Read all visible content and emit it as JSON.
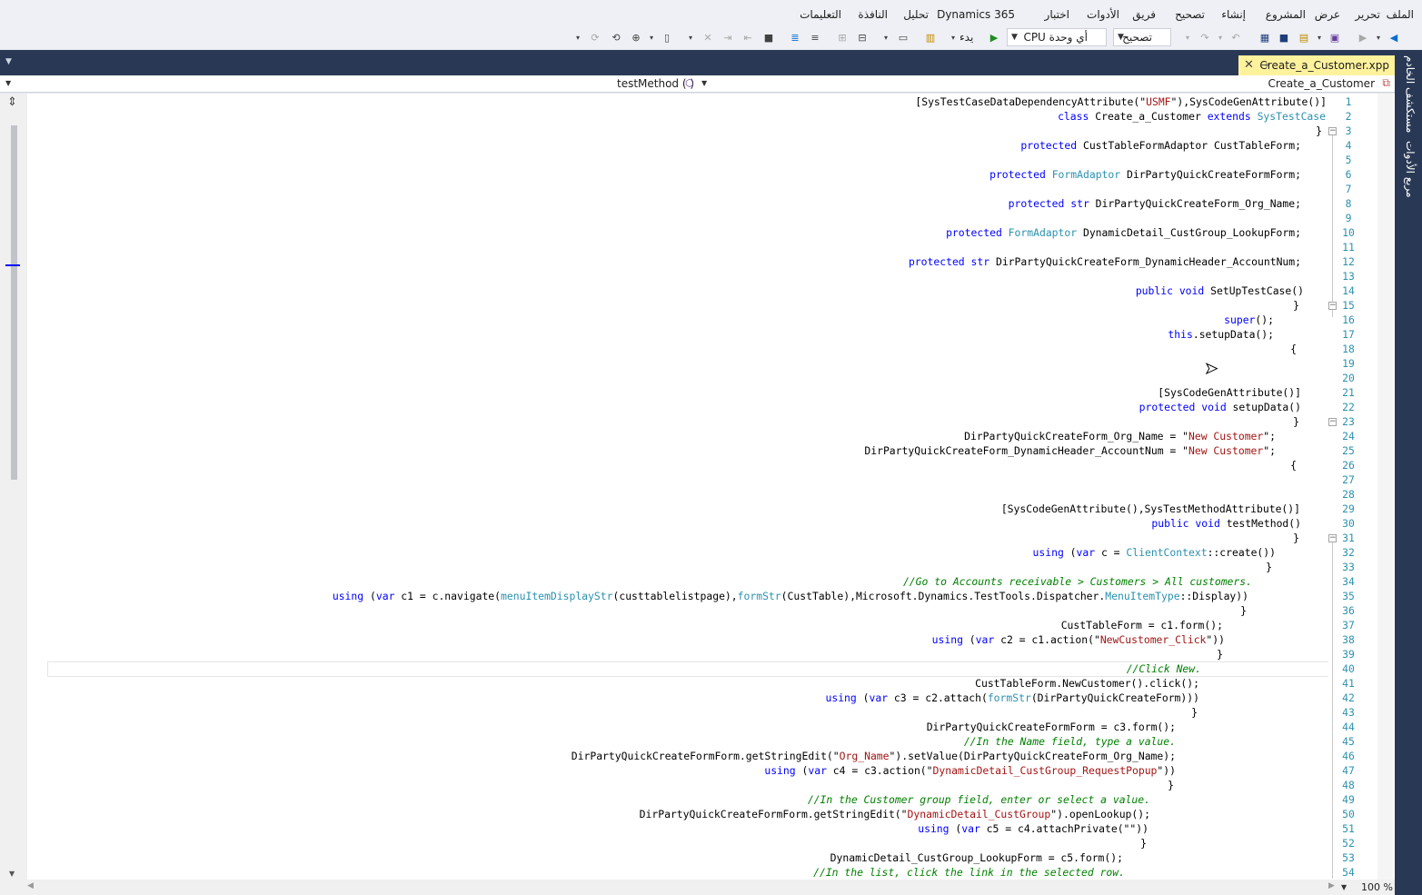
{
  "menu": [
    "الملف",
    "تحرير",
    "عرض",
    "المشروع",
    "إنشاء",
    "تصحيح",
    "فريق",
    "الأدوات",
    "اختبار",
    "Dynamics 365",
    "تحليل",
    "النافذة",
    "التعليمات"
  ],
  "toolbar": {
    "config": "تصحيح",
    "platform": "أي وحدة CPU",
    "start": "يدء"
  },
  "tab": {
    "title": "Create_a_Customer.xpp"
  },
  "side_tabs": [
    "مستكشف الخادم",
    "مربع الأدوات"
  ],
  "nav": {
    "method": "testMethod ( )",
    "class": "Create_a_Customer"
  },
  "zoom": "100 %",
  "line_numbers": [
    "1",
    "2",
    "3",
    "4",
    "5",
    "6",
    "7",
    "8",
    "9",
    "10",
    "11",
    "12",
    "13",
    "14",
    "15",
    "16",
    "17",
    "18",
    "19",
    "20",
    "21",
    "22",
    "23",
    "24",
    "25",
    "26",
    "27",
    "28",
    "29",
    "30",
    "31",
    "32",
    "33",
    "34",
    "35",
    "36",
    "37",
    "38",
    "39",
    "40",
    "41",
    "42",
    "43",
    "44",
    "45",
    "46",
    "47",
    "48",
    "49",
    "50",
    "51",
    "52",
    "53",
    "54"
  ],
  "code": [
    "[SysTestCaseDataDependencyAttribute(\"USMF\"),SysCodeGenAttribute()]",
    "class Create_a_Customer extends SysTestCase",
    "}",
    "protected CustTableFormAdaptor CustTableForm;",
    "",
    "protected FormAdaptor DirPartyQuickCreateFormForm;",
    "",
    "protected str DirPartyQuickCreateForm_Org_Name;",
    "",
    "protected FormAdaptor DynamicDetail_CustGroup_LookupForm;",
    "",
    "protected str DirPartyQuickCreateForm_DynamicHeader_AccountNum;",
    "",
    "public void SetUpTestCase()",
    "}",
    "super();",
    "this.setupData();",
    "{",
    "",
    "",
    "[SysCodeGenAttribute()]",
    "protected void setupData()",
    "}",
    "DirPartyQuickCreateForm_Org_Name = \"New Customer\";",
    "DirPartyQuickCreateForm_DynamicHeader_AccountNum = \"New Customer\";",
    "{",
    "",
    "",
    "[SysCodeGenAttribute(),SysTestMethodAttribute()]",
    "public void testMethod()",
    "}",
    "using (var c = ClientContext::create())",
    "}",
    "//Go to Accounts receivable > Customers > All customers.",
    "using (var c1 = c.navigate(menuItemDisplayStr(custtablelistpage),formStr(CustTable),Microsoft.Dynamics.TestTools.Dispatcher.MenuItemType::Display))",
    "}",
    "CustTableForm = c1.form();",
    "using (var c2 = c1.action(\"NewCustomer_Click\"))",
    "}",
    "//Click New.",
    "CustTableForm.NewCustomer().click();",
    "using (var c3 = c2.attach(formStr(DirPartyQuickCreateForm)))",
    "}",
    "DirPartyQuickCreateFormForm = c3.form();",
    "//In the Name field, type a value.",
    "DirPartyQuickCreateFormForm.getStringEdit(\"Org_Name\").setValue(DirPartyQuickCreateForm_Org_Name);",
    "using (var c4 = c3.action(\"DynamicDetail_CustGroup_RequestPopup\"))",
    "}",
    "//In the Customer group field, enter or select a value.",
    "DirPartyQuickCreateFormForm.getStringEdit(\"DynamicDetail_CustGroup\").openLookup();",
    "using (var c5 = c4.attachPrivate(\"\"))",
    "}",
    "DynamicDetail_CustGroup_LookupForm = c5.form();",
    "//In the list, click the link in the selected row."
  ],
  "colors": {
    "keyword": "#0000ff",
    "type": "#2b91af",
    "string": "#a31515",
    "comment": "#008000",
    "chrome_dark": "#293955",
    "tab_active": "#fff29d"
  }
}
